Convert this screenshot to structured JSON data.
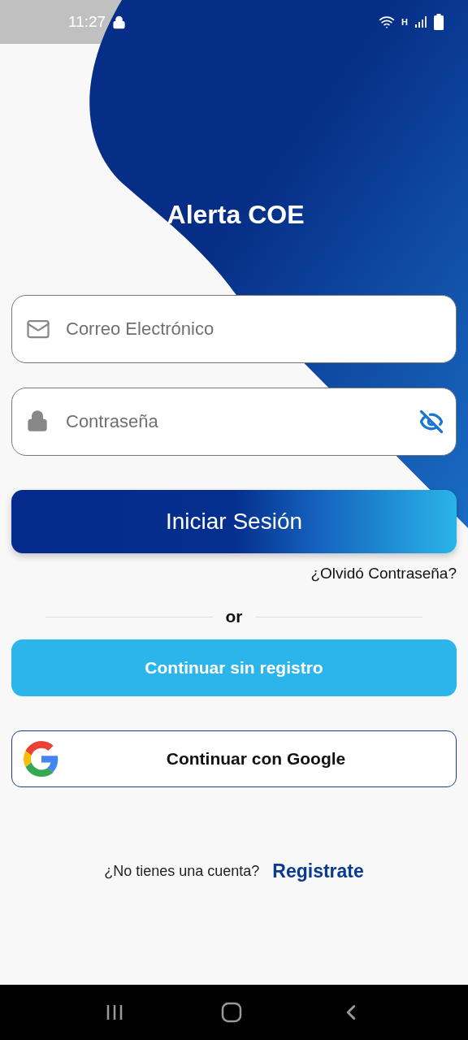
{
  "status_bar": {
    "time": "11:27",
    "network_type": "H"
  },
  "app_title": "Alerta COE",
  "email_field": {
    "placeholder": "Correo Electrónico"
  },
  "password_field": {
    "placeholder": "Contraseña",
    "password_visible": false
  },
  "login_button": "Iniciar Sesión",
  "forgot_link": "¿Olvidó Contraseña?",
  "divider_text": "or",
  "guest_button": "Continuar sin registro",
  "google_button": "Continuar con Google",
  "signup": {
    "prompt": "¿No tienes una cuenta?",
    "link": "Registrate"
  }
}
